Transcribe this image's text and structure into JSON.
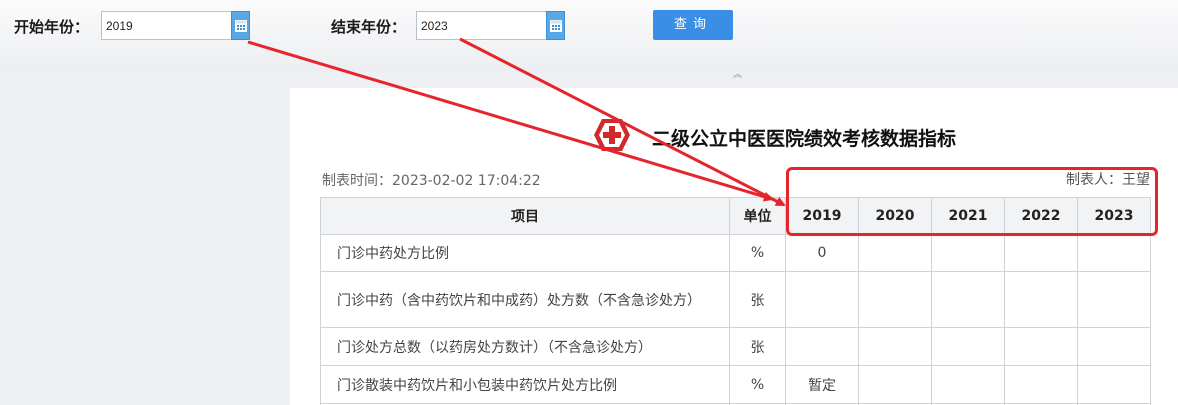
{
  "filters": {
    "start_label": "开始年份：",
    "start_value": "2019",
    "end_label": "结束年份：",
    "end_value": "2023",
    "query_label": "查询",
    "calendar_icon": "calendar-icon"
  },
  "report": {
    "title": "二级公立中医医院绩效考核数据指标",
    "created_time": "制表时间：2023-02-02 17:04:22",
    "creator": "制表人：王望",
    "table": {
      "headers": [
        "项目",
        "单位",
        "2019",
        "2020",
        "2021",
        "2022",
        "2023"
      ],
      "rows": [
        {
          "item": "门诊中药处方比例",
          "unit": "%",
          "values": [
            "0",
            "",
            "",
            "",
            ""
          ]
        },
        {
          "item": "门诊中药（含中药饮片和中成药）处方数（不含急诊处方）",
          "unit": "张",
          "values": [
            "",
            "",
            "",
            "",
            ""
          ]
        },
        {
          "item": "门诊处方总数（以药房处方数计）（不含急诊处方）",
          "unit": "张",
          "values": [
            "",
            "",
            "",
            "",
            ""
          ]
        },
        {
          "item": "门诊散装中药饮片和小包装中药饮片处方比例",
          "unit": "%",
          "values": [
            "暂定",
            "",
            "",
            "",
            ""
          ]
        }
      ]
    }
  },
  "annotation": {
    "color": "#e5242b"
  }
}
